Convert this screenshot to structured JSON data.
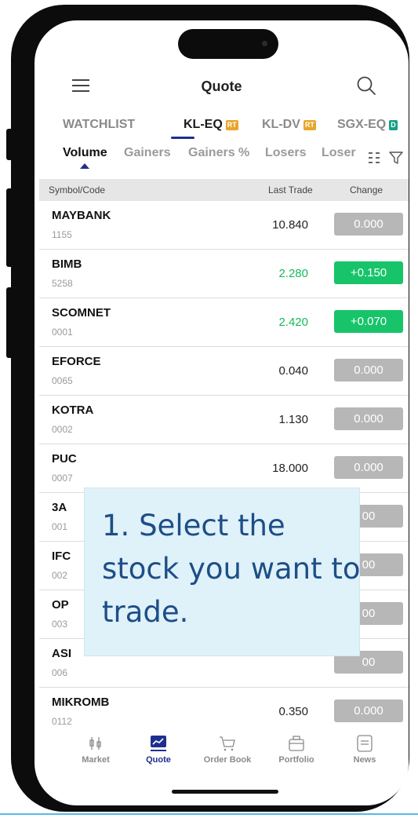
{
  "header": {
    "title": "Quote"
  },
  "exchange_tabs": [
    {
      "label": "WATCHLIST",
      "badge": "",
      "badge_color": ""
    },
    {
      "label": "KL-EQ",
      "badge": "RT",
      "badge_color": "#e9a52a"
    },
    {
      "label": "KL-DV",
      "badge": "RT",
      "badge_color": "#e9a52a"
    },
    {
      "label": "SGX-EQ",
      "badge": "D",
      "badge_color": "#16a085"
    }
  ],
  "sort_tabs": [
    "Volume",
    "Gainers",
    "Gainers %",
    "Losers",
    "Loser"
  ],
  "table": {
    "columns": {
      "symbol": "Symbol/Code",
      "last": "Last Trade",
      "change": "Change"
    },
    "rows": [
      {
        "symbol": "MAYBANK",
        "code": "1155",
        "last": "10.840",
        "change": "0.000",
        "direction": "flat"
      },
      {
        "symbol": "BIMB",
        "code": "5258",
        "last": "2.280",
        "change": "+0.150",
        "direction": "up"
      },
      {
        "symbol": "SCOMNET",
        "code": "0001",
        "last": "2.420",
        "change": "+0.070",
        "direction": "up"
      },
      {
        "symbol": "EFORCE",
        "code": "0065",
        "last": "0.040",
        "change": "0.000",
        "direction": "flat"
      },
      {
        "symbol": "KOTRA",
        "code": "0002",
        "last": "1.130",
        "change": "0.000",
        "direction": "flat"
      },
      {
        "symbol": "PUC",
        "code": "0007",
        "last": "18.000",
        "change": "0.000",
        "direction": "flat"
      },
      {
        "symbol": "3A",
        "code": "001",
        "last": "",
        "change": "00",
        "direction": "flat"
      },
      {
        "symbol": "IFC",
        "code": "002",
        "last": "",
        "change": "00",
        "direction": "flat"
      },
      {
        "symbol": "OP",
        "code": "003",
        "last": "",
        "change": "00",
        "direction": "flat"
      },
      {
        "symbol": "ASI",
        "code": "006",
        "last": "",
        "change": "00",
        "direction": "flat"
      },
      {
        "symbol": "MIKROMB",
        "code": "0112",
        "last": "0.350",
        "change": "0.000",
        "direction": "flat"
      }
    ]
  },
  "bottom_nav": [
    {
      "label": "Market",
      "icon": "market-icon"
    },
    {
      "label": "Quote",
      "icon": "quote-chart-icon",
      "active": true
    },
    {
      "label": "Order Book",
      "icon": "cart-icon"
    },
    {
      "label": "Portfolio",
      "icon": "briefcase-icon"
    },
    {
      "label": "News",
      "icon": "news-icon"
    }
  ],
  "callout": {
    "text": "1. Select the stock you want to trade."
  },
  "colors": {
    "up_green": "#17c46a",
    "flat_gray": "#b7b7b7",
    "accent_navy": "#1f2f8f",
    "callout_bg": "#dff1f9"
  }
}
